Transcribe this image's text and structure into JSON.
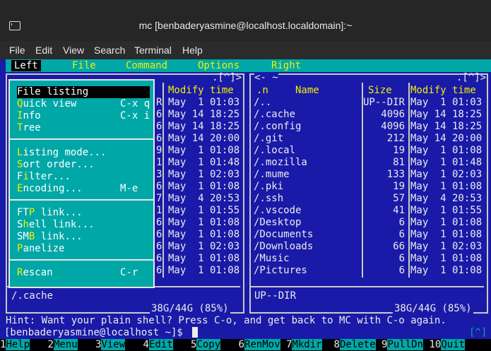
{
  "window": {
    "title": "mc [benbaderyasmine@localhost.localdomain]:~"
  },
  "app_menu": [
    "File",
    "Edit",
    "View",
    "Search",
    "Terminal",
    "Help"
  ],
  "mc_menu": [
    "Left",
    "File",
    "Command",
    "Options",
    "Right"
  ],
  "dropdown": {
    "items": [
      {
        "label": "File listing",
        "shortcut": ""
      },
      {
        "label": "Quick view",
        "shortcut": "C-x q"
      },
      {
        "label": "Info",
        "shortcut": "C-x i"
      },
      {
        "label": "Tree",
        "shortcut": ""
      },
      {
        "label": "Listing mode...",
        "shortcut": ""
      },
      {
        "label": "Sort order...",
        "shortcut": ""
      },
      {
        "label": "Filter...",
        "shortcut": ""
      },
      {
        "label": "Encoding...",
        "shortcut": "M-e"
      },
      {
        "label": "FTP link...",
        "shortcut": ""
      },
      {
        "label": "Shell link...",
        "shortcut": ""
      },
      {
        "label": "SMB link...",
        "shortcut": ""
      },
      {
        "label": "Panelize",
        "shortcut": ""
      },
      {
        "label": "Rescan",
        "shortcut": "C-r"
      }
    ]
  },
  "left_panel": {
    "header_indicator": ".[^]>",
    "col_modify": "Modify time",
    "size_fragments": [
      "R",
      "6",
      "6",
      "6",
      "9",
      "1",
      "3",
      "6",
      "7",
      "1",
      "6",
      "6",
      "6",
      "6",
      "6"
    ],
    "times": [
      "May  1 01:03",
      "May 14 18:25",
      "May 14 18:25",
      "May 14 20:00",
      "May  1 01:08",
      "May  1 01:48",
      "May  1 02:03",
      "May  1 01:08",
      "May  4 20:53",
      "May  1 01:55",
      "May  1 01:08",
      "May  1 01:08",
      "May  1 02:03",
      "May  1 01:08",
      "May  1 01:08"
    ],
    "status": "/.cache",
    "disk": "38G/44G (85%)"
  },
  "right_panel": {
    "header_left": "<- ~",
    "header_indicator": ".[^]>",
    "col_n": ".n",
    "col_name": "Name",
    "col_size": "Size",
    "col_modify": "Modify time",
    "rows": [
      {
        "name": "/..",
        "size": "UP--DIR",
        "time": "May  1 01:03"
      },
      {
        "name": "/.cache",
        "size": "4096",
        "time": "May 14 18:25"
      },
      {
        "name": "/.config",
        "size": "4096",
        "time": "May 14 18:25"
      },
      {
        "name": "/.git",
        "size": "212",
        "time": "May 14 20:00"
      },
      {
        "name": "/.local",
        "size": "19",
        "time": "May  1 01:08"
      },
      {
        "name": "/.mozilla",
        "size": "81",
        "time": "May  1 01:48"
      },
      {
        "name": "/.mume",
        "size": "133",
        "time": "May  1 02:03"
      },
      {
        "name": "/.pki",
        "size": "19",
        "time": "May  1 01:08"
      },
      {
        "name": "/.ssh",
        "size": "57",
        "time": "May  4 20:53"
      },
      {
        "name": "/.vscode",
        "size": "41",
        "time": "May  1 01:55"
      },
      {
        "name": "/Desktop",
        "size": "6",
        "time": "May  1 01:08"
      },
      {
        "name": "/Documents",
        "size": "6",
        "time": "May  1 01:08"
      },
      {
        "name": "/Downloads",
        "size": "66",
        "time": "May  1 02:03"
      },
      {
        "name": "/Music",
        "size": "6",
        "time": "May  1 01:08"
      },
      {
        "name": "/Pictures",
        "size": "6",
        "time": "May  1 01:08"
      }
    ],
    "status": "UP--DIR",
    "disk": "38G/44G (85%)"
  },
  "hint": "Hint: Want your plain shell? Press C-o, and get back to MC with C-o again.",
  "prompt": "[benbaderyasmine@localhost ~]$",
  "prompt_indicator": "[^]",
  "fkeys": [
    {
      "n": "1",
      "label": "Help"
    },
    {
      "n": "2",
      "label": "Menu"
    },
    {
      "n": "3",
      "label": "View"
    },
    {
      "n": "4",
      "label": "Edit"
    },
    {
      "n": "5",
      "label": "Copy"
    },
    {
      "n": "6",
      "label": "RenMov"
    },
    {
      "n": "7",
      "label": "Mkdir"
    },
    {
      "n": "8",
      "label": "Delete"
    },
    {
      "n": "9",
      "label": "PullDn"
    },
    {
      "n": "10",
      "label": "Quit"
    }
  ],
  "colors": {
    "panel_bg": "#1a1aa8",
    "menu_bg": "#00a7a7",
    "highlight": "#f0f000"
  }
}
